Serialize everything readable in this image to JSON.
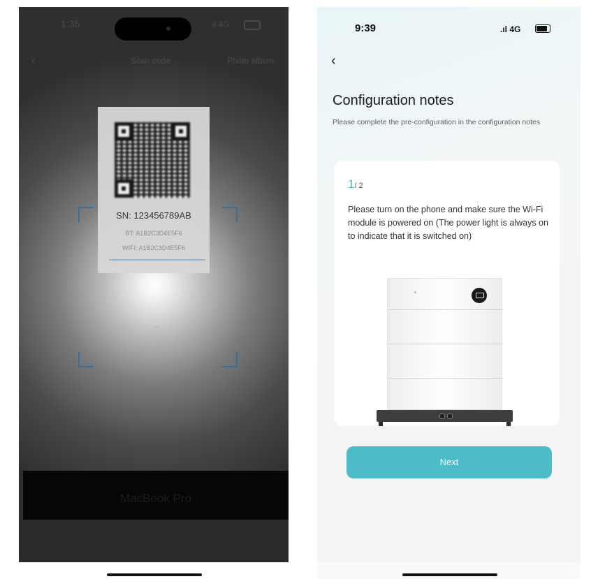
{
  "left_screen": {
    "status": {
      "time": "1:35",
      "network": "4G"
    },
    "nav": {
      "back": "‹",
      "title": "Scan code",
      "right": "Photo album"
    },
    "qr_card": {
      "sn": "SN: 123456789AB",
      "bt": "BT: A1B2C3D4E5F6",
      "wifi": "WIFI: A1B2C3D4E5F6"
    },
    "dock_label": "MacBook Pro"
  },
  "right_screen": {
    "status": {
      "time": "9:39",
      "network": "4G"
    },
    "back": "‹",
    "title": "Configuration notes",
    "subtitle": "Please complete the pre-configuration in the configuration notes",
    "step": {
      "current": "1",
      "total": "/ 2"
    },
    "description": "Please turn on the phone and make sure the Wi-Fi module is powered on (The power light is always on to indicate that it is switched on)",
    "next_label": "Next",
    "accent_color": "#4cbcc8"
  }
}
